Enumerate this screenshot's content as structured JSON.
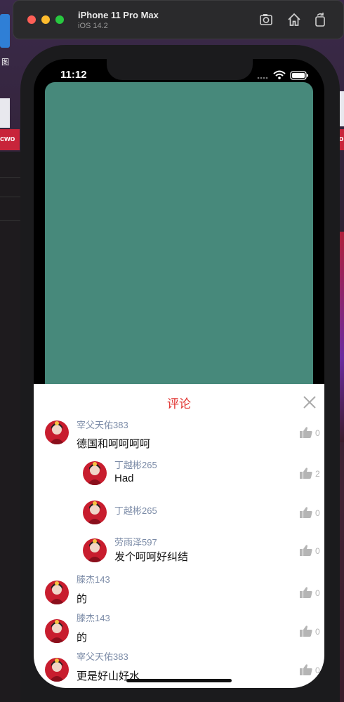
{
  "window": {
    "device_name": "iPhone 11 Pro Max",
    "os_version": "iOS 14.2",
    "toolbar_icons": [
      "screenshot-icon",
      "home-icon",
      "rotate-icon"
    ]
  },
  "desktop": {
    "left_label": "图",
    "left_file": "cwo",
    "right_file": "cwo"
  },
  "status_bar": {
    "time": "11:12"
  },
  "colors": {
    "card": "#47897b",
    "title": "#e0302d",
    "username": "#7a8aa6"
  },
  "comments_sheet": {
    "title": "评论",
    "comments": [
      {
        "user": "宰父天佑383",
        "text": "德国和呵呵呵呵",
        "likes": "0",
        "reply": false
      },
      {
        "user": "丁越彬265",
        "text": "Had",
        "likes": "2",
        "reply": true
      },
      {
        "user": "丁越彬265",
        "text": "",
        "likes": "0",
        "reply": true
      },
      {
        "user": "劳雨泽597",
        "text": "发个呵呵好纠结",
        "likes": "0",
        "reply": true
      },
      {
        "user": "滕杰143",
        "text": "的",
        "likes": "0",
        "reply": false
      },
      {
        "user": "滕杰143",
        "text": "的",
        "likes": "0",
        "reply": false
      },
      {
        "user": "宰父天佑383",
        "text": "更是好山好水",
        "likes": "0",
        "reply": false
      }
    ]
  }
}
